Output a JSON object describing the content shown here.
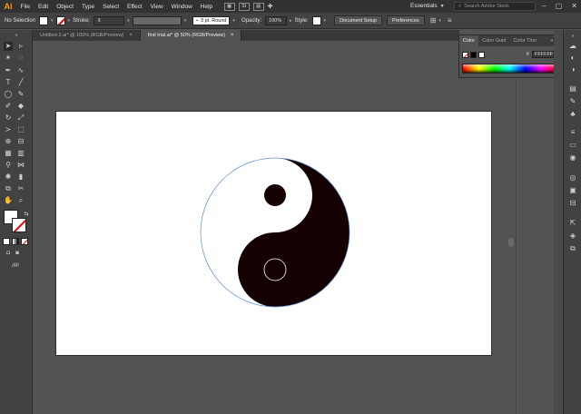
{
  "app": {
    "logo": "Ai"
  },
  "menu": [
    "File",
    "Edit",
    "Object",
    "Type",
    "Select",
    "Effect",
    "View",
    "Window",
    "Help"
  ],
  "menubar_icons": {
    "br": "Br",
    "st": "St"
  },
  "workspace": {
    "label": "Essentials"
  },
  "search": {
    "placeholder": "Search Adobe Stock"
  },
  "control": {
    "selection_label": "No Selection",
    "stroke_label": "Stroke:",
    "brush_label": "3 pt. Round",
    "opacity_label": "Opacity:",
    "opacity_value": "100%",
    "style_label": "Style:",
    "doc_setup": "Document Setup",
    "preferences": "Preferences"
  },
  "tabs": [
    {
      "label": "Untitled-2.ai* @ 100% (RGB/Preview)",
      "active": false
    },
    {
      "label": "first trial.ai* @ 50% (RGB/Preview)",
      "active": true
    }
  ],
  "color_panel": {
    "tabs": [
      "Color",
      "Color Guid",
      "Color Ther"
    ],
    "hex_label": "#",
    "hex_value": "FFFFFF"
  },
  "colors": {
    "yin": "#140000",
    "yang": "#ffffff",
    "selection_outline": "#5b8fd6",
    "accent": "#ff9a00"
  },
  "artwork": {
    "object": "yin-yang symbol"
  }
}
